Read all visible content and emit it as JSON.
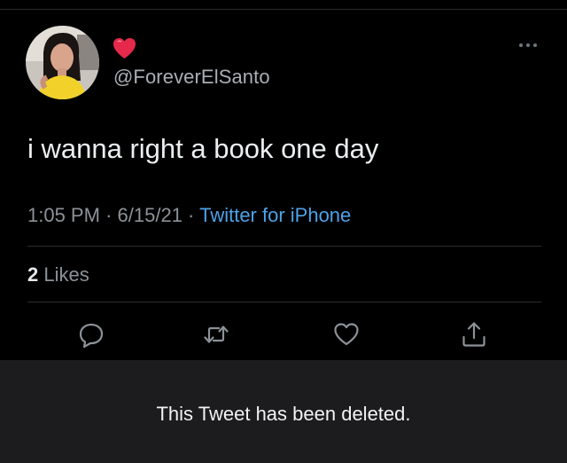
{
  "tweet": {
    "author": {
      "handle": "@ForeverElSanto",
      "avatar": "profile-photo",
      "name_emoji": "red-heart-emoji"
    },
    "text": "i wanna right a book one day",
    "time": "1:05 PM",
    "separator": "·",
    "date": "6/15/21",
    "source": "Twitter for iPhone",
    "likes_count": "2",
    "likes_label": "Likes"
  },
  "actions": {
    "reply": "reply-icon",
    "retweet": "retweet-icon",
    "like": "heart-icon",
    "share": "share-icon",
    "more": "more-icon"
  },
  "banner": {
    "text": "This Tweet has been deleted."
  },
  "colors": {
    "background": "#000000",
    "link": "#4ea1e8",
    "muted": "#8b9298",
    "banner": "#1c1c1e",
    "heart": "#e6294b"
  }
}
